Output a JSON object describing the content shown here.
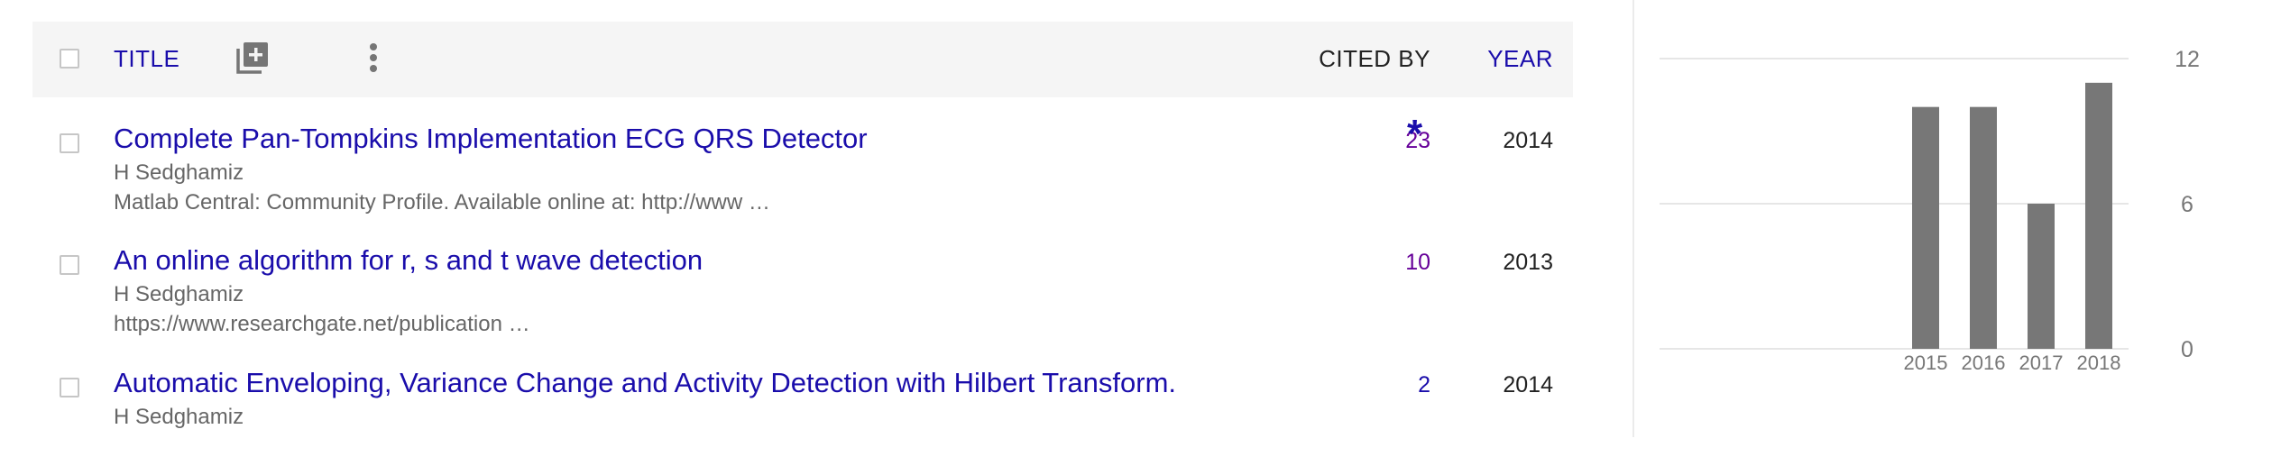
{
  "header": {
    "title_label": "TITLE",
    "cited_by_label": "CITED BY",
    "year_label": "YEAR"
  },
  "articles": [
    {
      "title": "Complete Pan-Tompkins Implementation ECG QRS Detector",
      "authors": "H Sedghamiz",
      "venue": "Matlab Central: Community Profile. Available online at: http://www …",
      "cited_by": "23",
      "star": "*",
      "year": "2014"
    },
    {
      "title": "An online algorithm for r, s and t wave detection",
      "authors": "H Sedghamiz",
      "venue": "https://www.researchgate.net/publication …",
      "cited_by": "10",
      "year": "2013"
    },
    {
      "title": "Automatic Enveloping, Variance Change and Activity Detection with Hilbert Transform.",
      "authors": "H Sedghamiz",
      "venue": "",
      "cited_by": "2",
      "year": "2014"
    }
  ],
  "colors": {
    "link": "#1a0dab",
    "visited": "#660099",
    "meta": "#666666",
    "bar": "#777777"
  },
  "icons": [
    "add-to-library-icon",
    "more-vert-icon"
  ],
  "chart_data": {
    "type": "bar",
    "categories": [
      "2015",
      "2016",
      "2017",
      "2018"
    ],
    "values": [
      10,
      10,
      6,
      11
    ],
    "yticks": [
      0,
      6,
      12
    ],
    "ylim": [
      0,
      12
    ],
    "title": "",
    "xlabel": "",
    "ylabel": "",
    "grid": true,
    "axis_side": "right"
  }
}
